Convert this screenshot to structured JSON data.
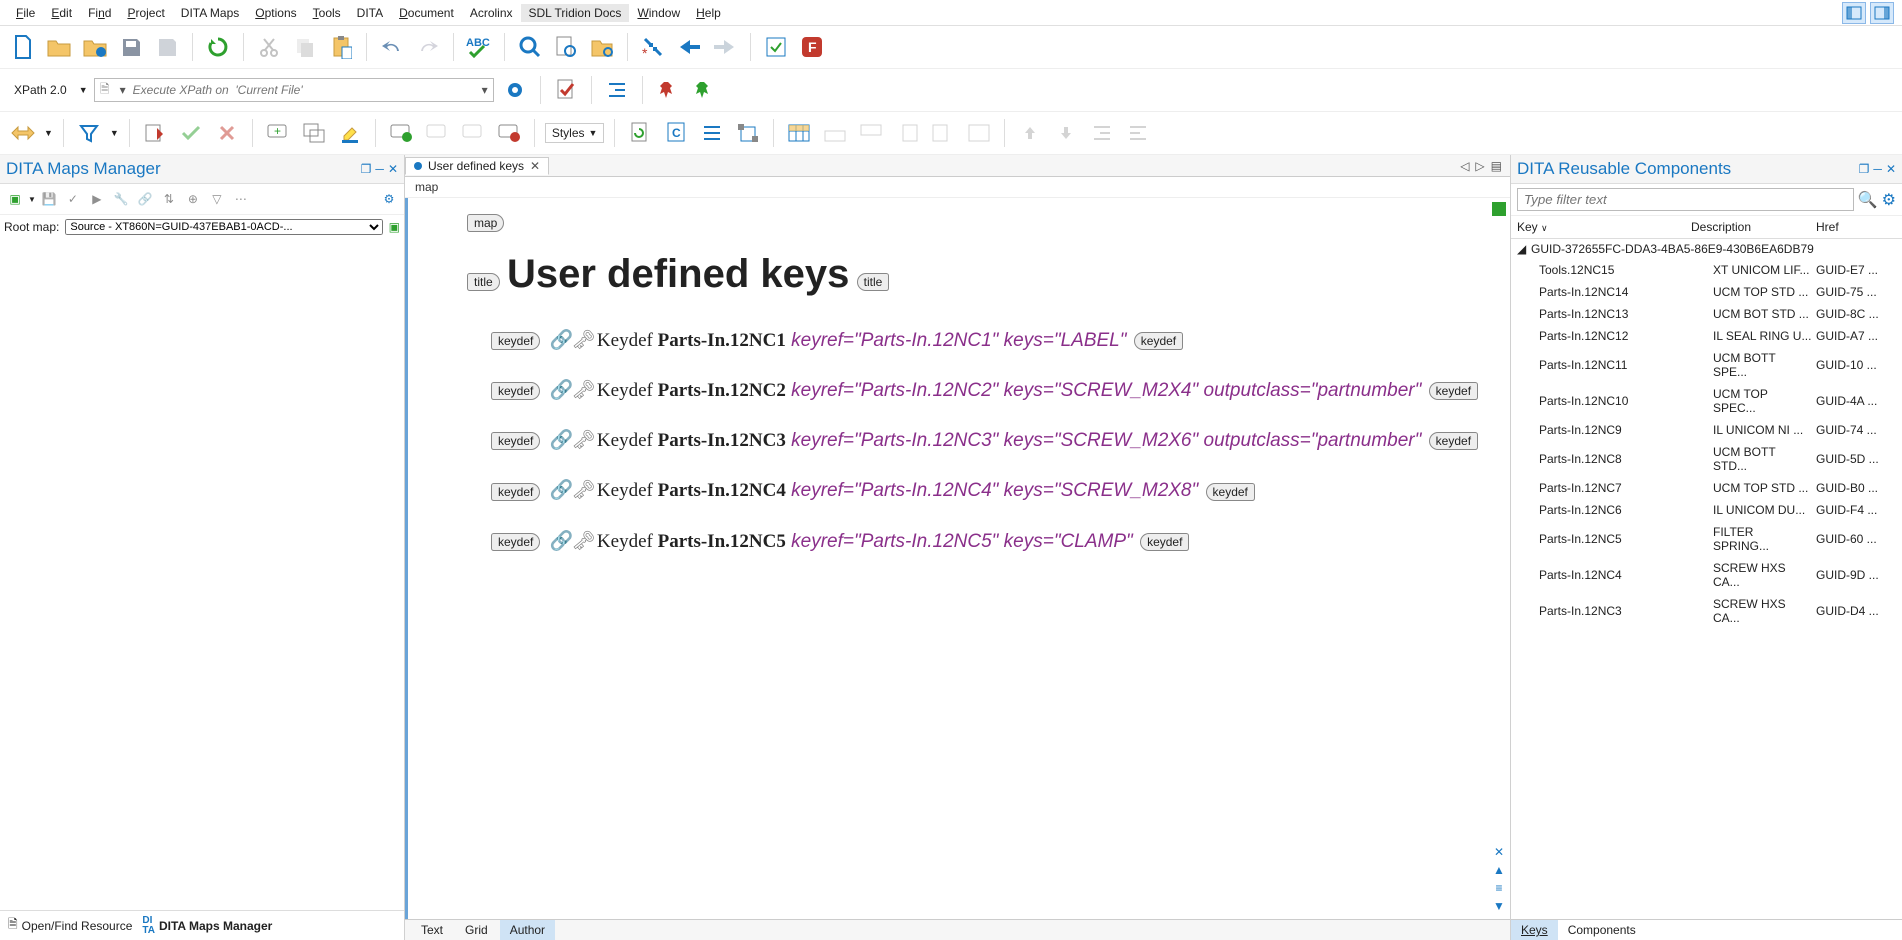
{
  "menu": {
    "items": [
      "File",
      "Edit",
      "Find",
      "Project",
      "DITA Maps",
      "Options",
      "Tools",
      "DITA",
      "Document",
      "Acrolinx",
      "SDL Tridion Docs",
      "Window",
      "Help"
    ]
  },
  "xpath": {
    "label": "XPath 2.0",
    "placeholder": "Execute XPath on  'Current File'"
  },
  "styles_label": "Styles",
  "left_panel": {
    "title": "DITA Maps Manager",
    "root_label": "Root map:",
    "root_value": "Source - XT860N=GUID-437EBAB1-0ACD-...",
    "bottom_tabs": [
      "Open/Find Resource",
      "DITA Maps Manager"
    ],
    "active_bottom_tab": 1
  },
  "editor": {
    "tab_title": "User defined keys",
    "breadcrumb": "map",
    "map_tag": "map",
    "title_tag": "title",
    "title_text": "User defined keys",
    "keydef_tag": "keydef",
    "keydefs": [
      {
        "label": "Keydef",
        "name": "Parts-In.12NC1",
        "attrs": "keyref=\"Parts-In.12NC1\" keys=\"LABEL\""
      },
      {
        "label": "Keydef",
        "name": "Parts-In.12NC2",
        "attrs": "keyref=\"Parts-In.12NC2\" keys=\"SCREW_M2X4\" outputclass=\"partnumber\""
      },
      {
        "label": "Keydef",
        "name": "Parts-In.12NC3",
        "attrs": "keyref=\"Parts-In.12NC3\" keys=\"SCREW_M2X6\" outputclass=\"partnumber\""
      },
      {
        "label": "Keydef",
        "name": "Parts-In.12NC4",
        "attrs": "keyref=\"Parts-In.12NC4\" keys=\"SCREW_M2X8\""
      },
      {
        "label": "Keydef",
        "name": "Parts-In.12NC5",
        "attrs": "keyref=\"Parts-In.12NC5\" keys=\"CLAMP\""
      }
    ],
    "bottom_tabs": [
      "Text",
      "Grid",
      "Author"
    ],
    "active_bottom_tab": 2
  },
  "right_panel": {
    "title": "DITA Reusable Components",
    "filter_placeholder": "Type filter text",
    "columns": {
      "key": "Key",
      "desc": "Description",
      "href": "Href"
    },
    "group": "GUID-372655FC-DDA3-4BA5-86E9-430B6EA6DB79",
    "rows": [
      {
        "key": "Tools.12NC15",
        "desc": "XT UNICOM LIF...",
        "href": "GUID-E7 ..."
      },
      {
        "key": "Parts-In.12NC14",
        "desc": "UCM TOP STD ...",
        "href": "GUID-75 ..."
      },
      {
        "key": "Parts-In.12NC13",
        "desc": "UCM BOT STD ...",
        "href": "GUID-8C ..."
      },
      {
        "key": "Parts-In.12NC12",
        "desc": "IL SEAL RING U...",
        "href": "GUID-A7 ..."
      },
      {
        "key": "Parts-In.12NC11",
        "desc": "UCM BOTT SPE...",
        "href": "GUID-10 ..."
      },
      {
        "key": "Parts-In.12NC10",
        "desc": "UCM TOP SPEC...",
        "href": "GUID-4A ..."
      },
      {
        "key": "Parts-In.12NC9",
        "desc": "IL UNICOM NI ...",
        "href": "GUID-74 ..."
      },
      {
        "key": "Parts-In.12NC8",
        "desc": "UCM BOTT STD...",
        "href": "GUID-5D ..."
      },
      {
        "key": "Parts-In.12NC7",
        "desc": "UCM TOP STD ...",
        "href": "GUID-B0 ..."
      },
      {
        "key": "Parts-In.12NC6",
        "desc": "IL UNICOM DU...",
        "href": "GUID-F4 ..."
      },
      {
        "key": "Parts-In.12NC5",
        "desc": "FILTER SPRING...",
        "href": "GUID-60 ..."
      },
      {
        "key": "Parts-In.12NC4",
        "desc": "SCREW HXS CA...",
        "href": "GUID-9D ..."
      },
      {
        "key": "Parts-In.12NC3",
        "desc": "SCREW HXS CA...",
        "href": "GUID-D4 ..."
      }
    ],
    "bottom_tabs": [
      "Keys",
      "Components"
    ],
    "active_bottom_tab": 0
  },
  "icons": {
    "accent": "#1a78c2",
    "green": "#2ea02e",
    "orange": "#e68a1f",
    "red": "#c23a2e"
  }
}
